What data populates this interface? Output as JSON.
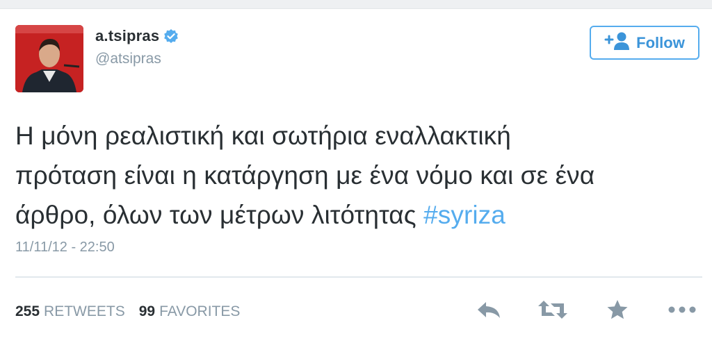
{
  "user": {
    "display_name": "a.tsipras",
    "handle": "@atsipras",
    "verified": true
  },
  "follow_button": {
    "label": "Follow",
    "icon": "add-user-icon"
  },
  "tweet": {
    "text_lines": [
      "Η μόνη ρεαλιστική και σωτήρια εναλλακτική",
      "πρόταση είναι η κατάργηση με ένα νόμο και σε ένα",
      "άρθρο, όλων των μέτρων λιτότητας "
    ],
    "hashtag": "#syriza",
    "timestamp": "11/11/12 - 22:50"
  },
  "stats": {
    "retweets_count": "255",
    "retweets_label": "RETWEETS",
    "favorites_count": "99",
    "favorites_label": "FAVORITES"
  },
  "actions": [
    "reply-icon",
    "retweet-icon",
    "favorite-icon",
    "more-icon"
  ],
  "colors": {
    "accent": "#55acee",
    "text": "#292f33",
    "muted": "#8899a6",
    "icon": "#8899a6"
  }
}
